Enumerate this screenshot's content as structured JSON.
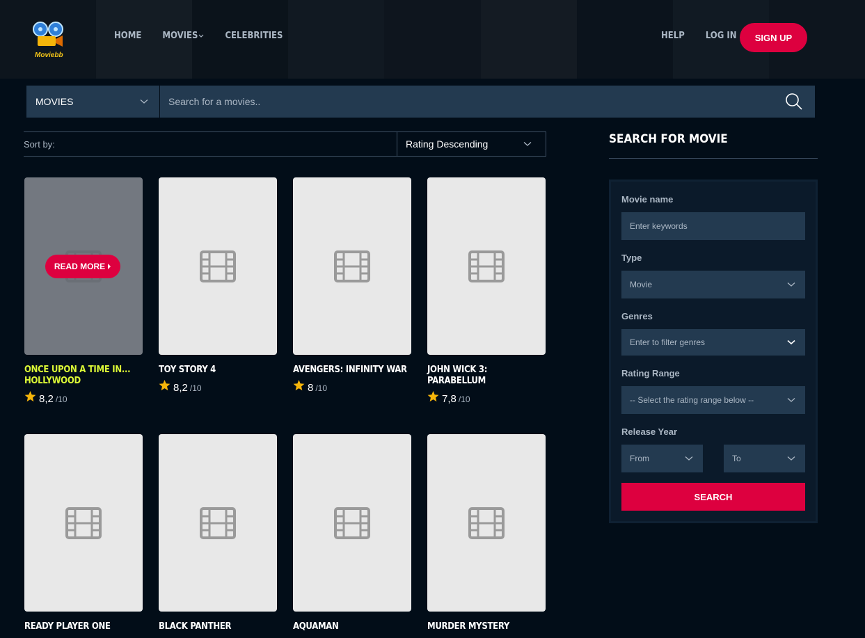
{
  "brand": {
    "logo_text": "Moviebb"
  },
  "nav": {
    "left": [
      {
        "label": "HOME",
        "name": "nav-home"
      },
      {
        "label": "MOVIES",
        "name": "nav-movies"
      },
      {
        "label": "CELEBRITIES",
        "name": "nav-celebrities"
      }
    ],
    "right": [
      {
        "label": "HELP",
        "name": "nav-help"
      },
      {
        "label": "LOG IN",
        "name": "nav-login"
      }
    ],
    "signup_label": "SIGN UP"
  },
  "top_search": {
    "category": "MOVIES",
    "placeholder": "Search for a movies.."
  },
  "sort": {
    "label": "Sort by:",
    "value": "Rating Descending"
  },
  "movies": [
    {
      "title": "ONCE UPON A TIME IN... HOLLYWOOD",
      "score": "8,2",
      "outof": "/10",
      "hovered": true
    },
    {
      "title": "TOY STORY 4",
      "score": "8,2",
      "outof": "/10"
    },
    {
      "title": "AVENGERS: INFINITY WAR",
      "score": "8",
      "outof": "/10"
    },
    {
      "title": "JOHN WICK 3: PARABELLUM",
      "score": "7,8",
      "outof": "/10"
    },
    {
      "title": "READY PLAYER ONE"
    },
    {
      "title": "BLACK PANTHER"
    },
    {
      "title": "AQUAMAN"
    },
    {
      "title": "MURDER MYSTERY"
    }
  ],
  "read_more_label": "READ MORE",
  "sidebar": {
    "title": "SEARCH FOR MOVIE",
    "movie_name_label": "Movie name",
    "movie_name_placeholder": "Enter keywords",
    "type_label": "Type",
    "type_value": "Movie",
    "genres_label": "Genres",
    "genres_placeholder": "Enter to filter genres",
    "rating_label": "Rating Range",
    "rating_value": "-- Select the rating range below --",
    "year_label": "Release Year",
    "year_from": "From",
    "year_to": "To",
    "search_label": "SEARCH"
  },
  "colors": {
    "accent": "#dd003f",
    "highlight": "#dcf836",
    "star": "#f5b50a",
    "background": "#020d18",
    "field": "#233a50"
  }
}
